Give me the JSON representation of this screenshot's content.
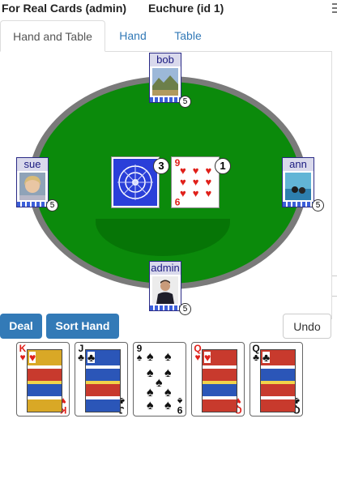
{
  "header": {
    "title_left": "For Real Cards (admin)",
    "title_right": "Euchure (id 1)"
  },
  "tabs": [
    {
      "label": "Hand and Table"
    },
    {
      "label": "Hand"
    },
    {
      "label": "Table"
    }
  ],
  "players": {
    "top": {
      "name": "bob",
      "count": "5"
    },
    "left": {
      "name": "sue",
      "count": "5"
    },
    "right": {
      "name": "ann",
      "count": "5"
    },
    "bottom": {
      "name": "admin",
      "count": "5"
    }
  },
  "table_piles": [
    {
      "face": "back",
      "count": "3"
    },
    {
      "face": "9 of hearts",
      "rank": "9",
      "suit": "♥",
      "count": "1"
    }
  ],
  "buttons": {
    "deal": "Deal",
    "sort": "Sort Hand",
    "undo": "Undo"
  },
  "hand": [
    {
      "rank": "K",
      "suit": "♥"
    },
    {
      "rank": "J",
      "suit": "♣"
    },
    {
      "rank": "9",
      "suit": "♠"
    },
    {
      "rank": "Q",
      "suit": "♥"
    },
    {
      "rank": "Q",
      "suit": "♣"
    }
  ],
  "colors": {
    "felt": "#0b8a0b",
    "rim": "#7a7a7a",
    "button": "#337ab7",
    "card_back": "#2a3fd9"
  }
}
